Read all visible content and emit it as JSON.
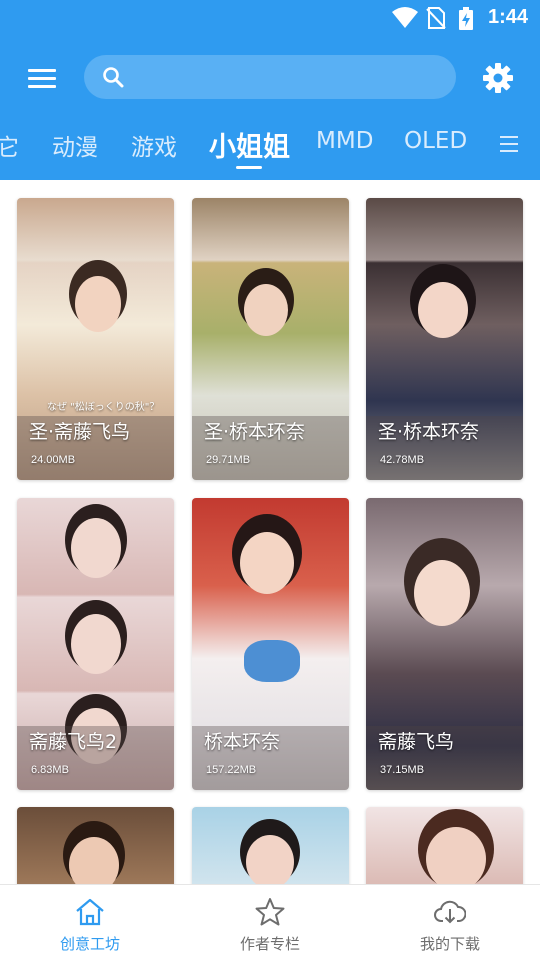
{
  "status_bar": {
    "time": "1:44"
  },
  "search": {
    "placeholder": ""
  },
  "tabs": [
    {
      "label": "它"
    },
    {
      "label": "动漫"
    },
    {
      "label": "游戏"
    },
    {
      "label": "小姐姐",
      "active": true
    },
    {
      "label": "MMD"
    },
    {
      "label": "OLED"
    }
  ],
  "cards": [
    {
      "title": "圣·斋藤飞鸟",
      "size": "24.00MB",
      "caption": "なぜ \"松ぼっくりの秋\"？"
    },
    {
      "title": "圣·桥本环奈",
      "size": "29.71MB"
    },
    {
      "title": "圣·桥本环奈",
      "size": "42.78MB"
    },
    {
      "title": "斋藤飞鸟2",
      "size": "6.83MB"
    },
    {
      "title": "桥本环奈",
      "size": "157.22MB"
    },
    {
      "title": "斋藤飞鸟",
      "size": "37.15MB"
    }
  ],
  "bottom_nav": [
    {
      "label": "创意工坊",
      "icon": "home-icon",
      "active": true
    },
    {
      "label": "作者专栏",
      "icon": "star-icon"
    },
    {
      "label": "我的下载",
      "icon": "cloud-download-icon"
    }
  ],
  "colors": {
    "primary": "#2f9bf0",
    "inactive": "#6d6d6d"
  }
}
